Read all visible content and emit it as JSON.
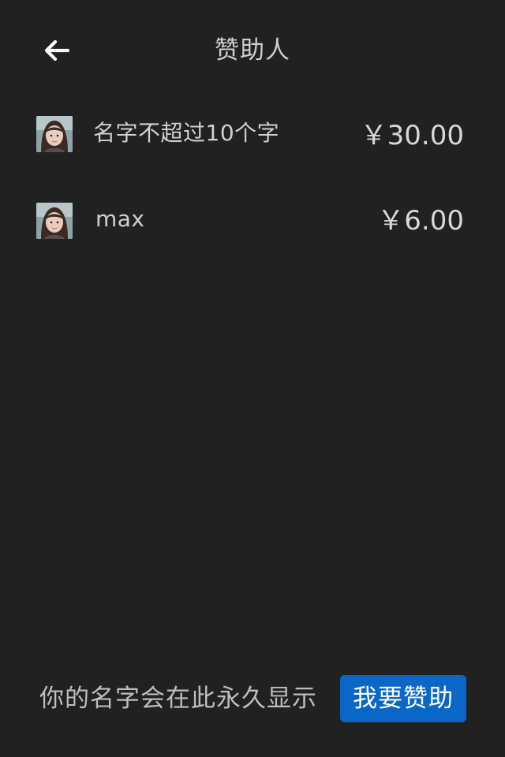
{
  "header": {
    "back_icon": "arrow-left-icon",
    "title": "赞助人"
  },
  "sponsors": [
    {
      "name": "名字不超过10个字",
      "amount": "￥30.00",
      "avatar": "avatar-portrait"
    },
    {
      "name": "max",
      "amount": "￥6.00",
      "avatar": "avatar-portrait"
    }
  ],
  "footer": {
    "notice": "你的名字会在此永久显示",
    "sponsor_button_label": "我要赞助"
  },
  "colors": {
    "background": "#212121",
    "accent": "#0a67c8",
    "text": "#d7d7d7"
  }
}
